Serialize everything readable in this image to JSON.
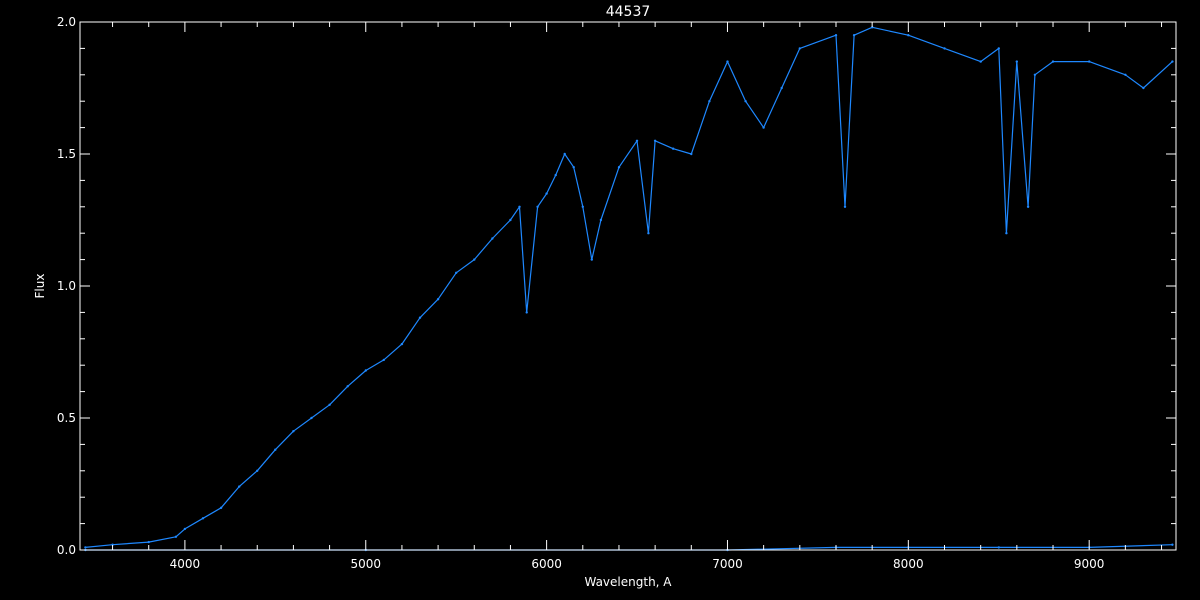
{
  "chart_data": {
    "type": "line",
    "title": "44537",
    "xlabel": "Wavelength, A",
    "ylabel": "Flux",
    "xlim": [
      3420,
      9480
    ],
    "ylim": [
      0.0,
      2.0
    ],
    "x_ticks": [
      4000,
      5000,
      6000,
      7000,
      8000,
      9000
    ],
    "x_tick_labels": [
      "4000",
      "5000",
      "6000",
      "7000",
      "8000",
      "9000"
    ],
    "y_ticks": [
      0.0,
      0.5,
      1.0,
      1.5,
      2.0
    ],
    "y_tick_labels": [
      "0.0",
      "0.5",
      "1.0",
      "1.5",
      "2.0"
    ],
    "grid": false,
    "background": "#000000",
    "axis_color": "#ffffff",
    "series": [
      {
        "color": "#1e88ff",
        "x": [
          3450,
          3600,
          3800,
          3950,
          4000,
          4100,
          4200,
          4300,
          4400,
          4500,
          4600,
          4700,
          4800,
          4900,
          5000,
          5100,
          5200,
          5300,
          5400,
          5500,
          5600,
          5700,
          5800,
          5850,
          5890,
          5950,
          6000,
          6050,
          6100,
          6150,
          6200,
          6250,
          6300,
          6400,
          6500,
          6563,
          6600,
          6700,
          6800,
          6900,
          7000,
          7100,
          7200,
          7300,
          7400,
          7600,
          7650,
          7700,
          7800,
          8000,
          8200,
          8400,
          8500,
          8542,
          8600,
          8662,
          8700,
          8800,
          9000,
          9200,
          9300,
          9460
        ],
        "values": [
          0.01,
          0.02,
          0.03,
          0.05,
          0.08,
          0.12,
          0.16,
          0.24,
          0.3,
          0.38,
          0.45,
          0.5,
          0.55,
          0.62,
          0.68,
          0.72,
          0.78,
          0.88,
          0.95,
          1.05,
          1.1,
          1.18,
          1.25,
          1.3,
          0.9,
          1.3,
          1.35,
          1.42,
          1.5,
          1.45,
          1.3,
          1.1,
          1.25,
          1.45,
          1.55,
          1.2,
          1.55,
          1.52,
          1.5,
          1.7,
          1.85,
          1.7,
          1.6,
          1.75,
          1.9,
          1.95,
          1.3,
          1.95,
          1.98,
          1.95,
          1.9,
          1.85,
          1.9,
          1.2,
          1.85,
          1.3,
          1.8,
          1.85,
          1.85,
          1.8,
          1.75,
          1.85
        ]
      },
      {
        "color": "#1e88ff",
        "x": [
          3450,
          5000,
          7000,
          7600,
          8000,
          8500,
          9000,
          9460
        ],
        "values": [
          0.0,
          0.0,
          0.0,
          0.01,
          0.01,
          0.01,
          0.01,
          0.02
        ]
      }
    ]
  }
}
